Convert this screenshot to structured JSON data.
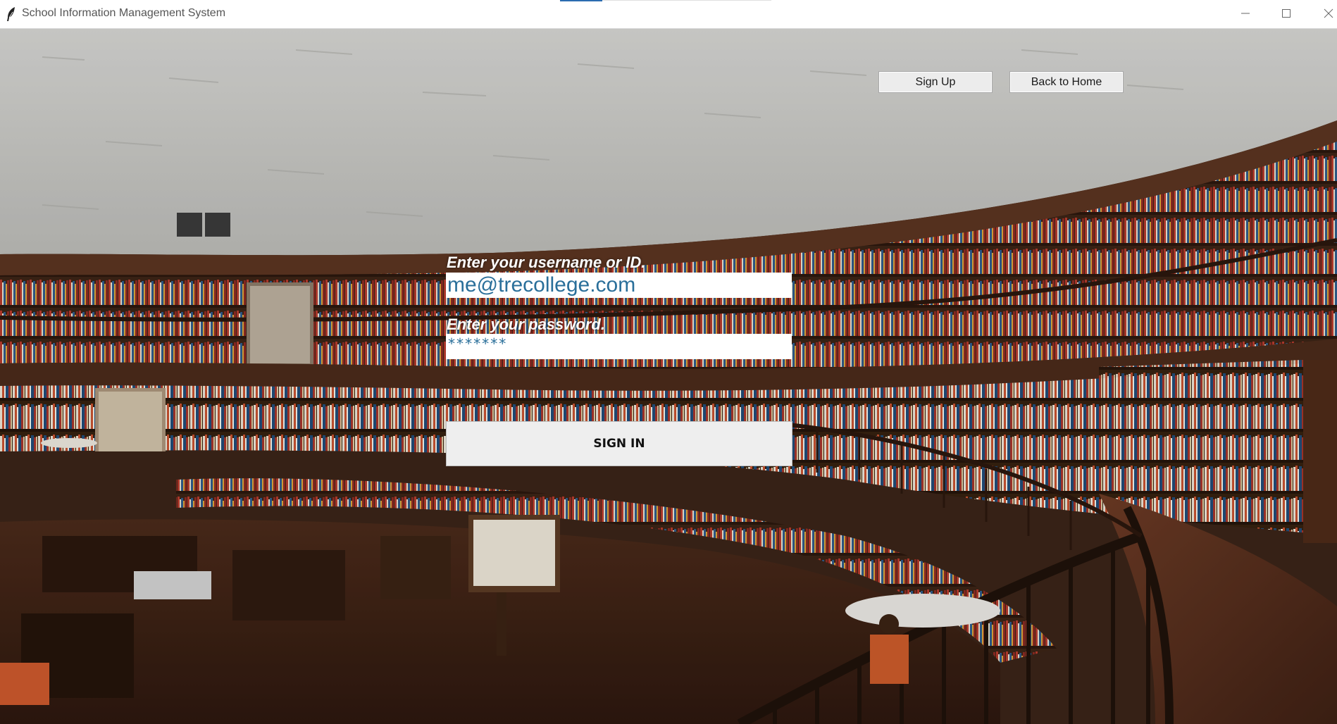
{
  "window": {
    "title": "School Information Management System",
    "app_icon": "feather-icon",
    "controls": {
      "minimize_icon": "minimize-icon",
      "maximize_icon": "maximize-icon",
      "close_icon": "close-icon"
    }
  },
  "header_buttons": {
    "signup_label": "Sign Up",
    "home_label": "Back to Home"
  },
  "login_form": {
    "username_label": "Enter your username or ID.",
    "username_value": "me@trecollege.com",
    "password_label": "Enter your password.",
    "password_value": "*******",
    "submit_label": "SIGN IN"
  },
  "background": {
    "subject": "library-interior-photo"
  },
  "colors": {
    "field_text": "#2a6f9a",
    "label_text": "#ffffff",
    "button_face": "#eeeeee",
    "wood_dark": "#3a2418",
    "ceiling": "#c9c9c6"
  }
}
